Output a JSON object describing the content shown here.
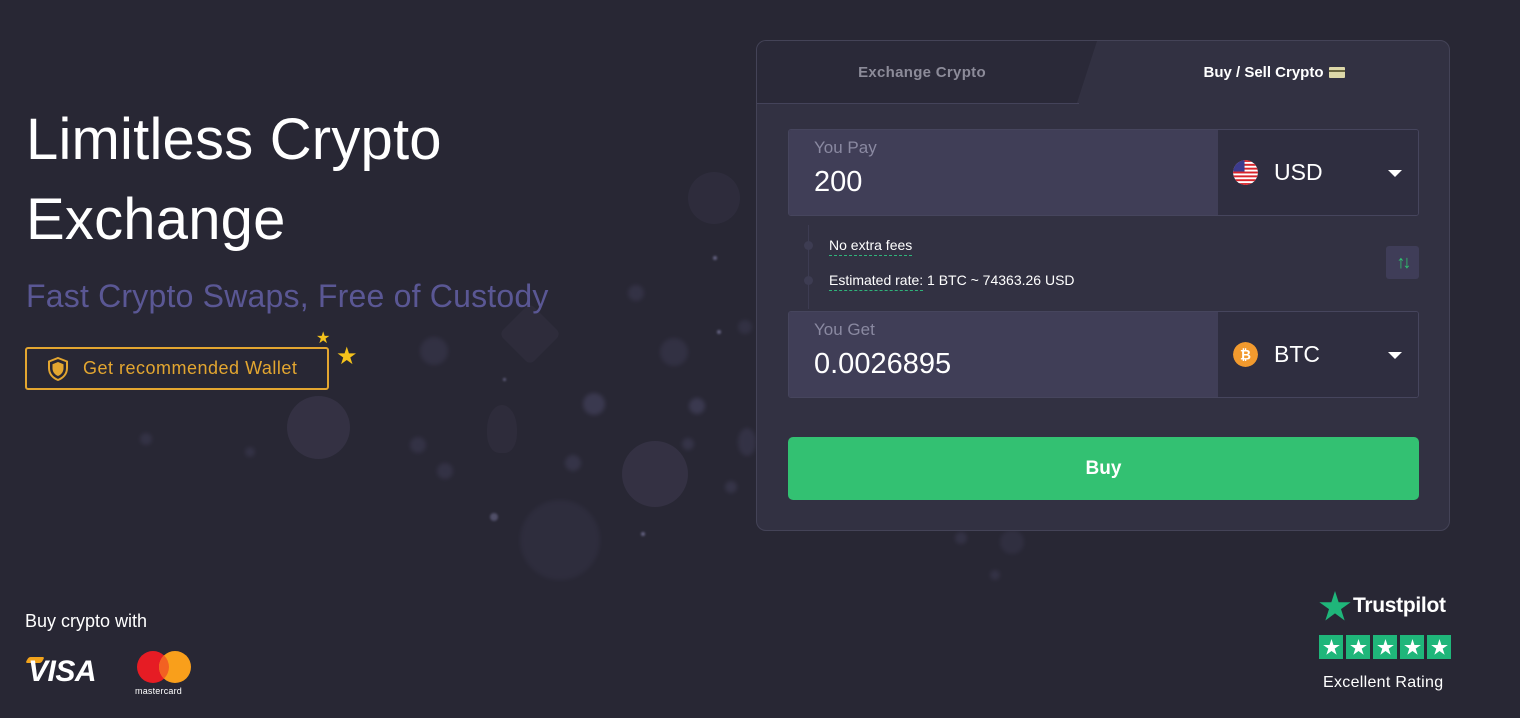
{
  "hero": {
    "title": "Limitless Crypto Exchange",
    "subtitle": "Fast Crypto Swaps, Free of Custody",
    "wallet_button": "Get recommended Wallet"
  },
  "card": {
    "tabs": [
      {
        "label": "Exchange Crypto",
        "active": false
      },
      {
        "label": "Buy / Sell Crypto",
        "active": true
      }
    ],
    "pay": {
      "label": "You Pay",
      "value": "200",
      "currency": "USD",
      "currency_icon": "us-flag-icon"
    },
    "info": {
      "fees": "No extra fees",
      "rate_label": "Estimated rate:",
      "rate_value": "1 BTC ~ 74363.26 USD"
    },
    "get": {
      "label": "You Get",
      "value": "0.0026895",
      "currency": "BTC",
      "currency_icon": "bitcoin-icon"
    },
    "buy_button": "Buy",
    "swap_icon": "⇅"
  },
  "payment": {
    "heading": "Buy crypto with",
    "methods": [
      "VISA",
      "mastercard"
    ]
  },
  "trustpilot": {
    "brand": "Trustpilot",
    "stars": 5,
    "rating_label": "Excellent Rating"
  },
  "colors": {
    "background": "#282734",
    "card": "#323142",
    "accent_green": "#33c172",
    "accent_gold": "#e3a630",
    "subtitle_purple": "#5a5794",
    "trustpilot_green": "#1fb67a"
  }
}
